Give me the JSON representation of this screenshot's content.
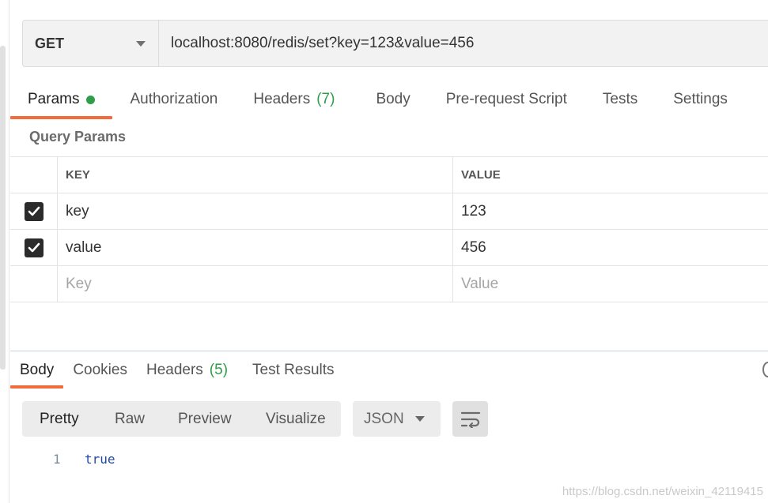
{
  "request": {
    "method": "GET",
    "url": "localhost:8080/redis/set?key=123&value=456"
  },
  "request_tabs": [
    {
      "label": "Params",
      "badge": "",
      "active": true,
      "dot": true
    },
    {
      "label": "Authorization",
      "badge": ""
    },
    {
      "label": "Headers",
      "badge": "(7)"
    },
    {
      "label": "Body",
      "badge": ""
    },
    {
      "label": "Pre-request Script",
      "badge": ""
    },
    {
      "label": "Tests",
      "badge": ""
    },
    {
      "label": "Settings",
      "badge": ""
    }
  ],
  "query_params": {
    "title": "Query Params",
    "columns": {
      "key": "KEY",
      "value": "VALUE"
    },
    "rows": [
      {
        "key": "key",
        "value": "123",
        "checked": true
      },
      {
        "key": "value",
        "value": "456",
        "checked": true
      }
    ],
    "placeholder": {
      "key": "Key",
      "value": "Value"
    }
  },
  "response_tabs": [
    {
      "label": "Body",
      "badge": "",
      "active": true
    },
    {
      "label": "Cookies",
      "badge": ""
    },
    {
      "label": "Headers",
      "badge": "(5)"
    },
    {
      "label": "Test Results",
      "badge": ""
    }
  ],
  "response_toolbar": {
    "modes": [
      "Pretty",
      "Raw",
      "Preview",
      "Visualize"
    ],
    "active_mode": "Pretty",
    "format": "JSON"
  },
  "response_body": {
    "lines": [
      {
        "number": "1",
        "text": "true"
      }
    ]
  },
  "watermark": "https://blog.csdn.net/weixin_42119415",
  "colors": {
    "accent": "#f26b3a",
    "badge_green": "#2e9e49",
    "code_blue": "#1f4aa8"
  }
}
